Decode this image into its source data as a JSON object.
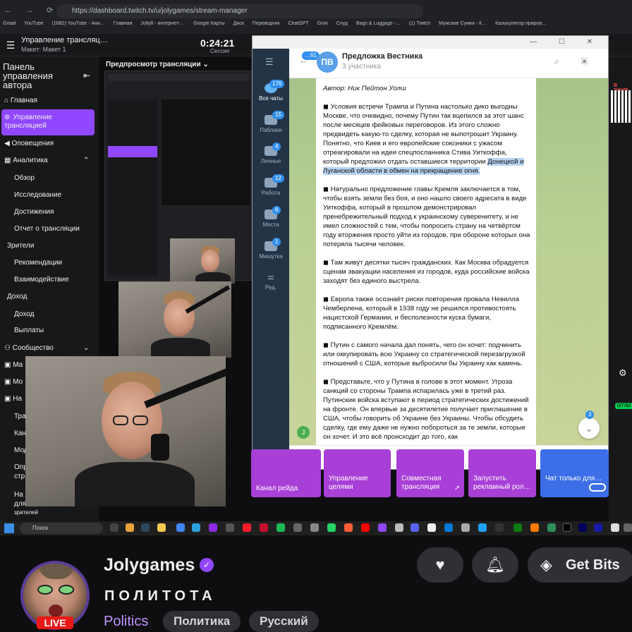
{
  "browser": {
    "url": "https://dashboard.twitch.tv/u/jolygames/stream-manager",
    "nav": "← → ⟳ ⌂",
    "bookmarks": [
      "Gmail",
      "YouTube",
      "(1682) YouTube - Ани…",
      "Главная",
      "Jolly8 - интернет-…",
      "Google Карты",
      "Диск",
      "Переводчик",
      "ChatGPT",
      "Grok",
      "Спуд",
      "Bags & Luggage -…",
      "(1) Twitch",
      "Мужские Сумки - К…",
      "Калькулятор приров…"
    ]
  },
  "twitch_header": {
    "title": "Управление трансляц…",
    "subtitle": "Макет: Макет 1",
    "session_time": "0:24:21",
    "session_label": "Сессия",
    "menu_icon": "hamburger-icon"
  },
  "sidebar": {
    "title": "Панель управления автора",
    "items": [
      {
        "label": "Главная",
        "icon": "home-icon"
      },
      {
        "label": "Управление трансляцией",
        "icon": "broadcast-icon",
        "active": true
      },
      {
        "label": "Оповещения",
        "icon": "megaphone-icon"
      },
      {
        "label": "Аналитика",
        "icon": "analytics-icon"
      },
      {
        "label": "Обзор"
      },
      {
        "label": "Исследование"
      },
      {
        "label": "Достижения"
      },
      {
        "label": "Отчет о трансляции"
      },
      {
        "label": "Зрители"
      },
      {
        "label": "Рекомендации"
      },
      {
        "label": "Взаимодействие"
      },
      {
        "label": "Доход"
      },
      {
        "label": "Доход"
      },
      {
        "label": "Выплаты"
      },
      {
        "label": "Сообщество",
        "icon": "community-icon"
      },
      {
        "label": "Ма"
      },
      {
        "label": "Мо"
      },
      {
        "label": "На"
      },
      {
        "label": "Тра"
      },
      {
        "label": "Кан"
      },
      {
        "label": "Мод"
      },
      {
        "label": "Опр"
      },
      {
        "label": "стр"
      },
      {
        "label": "На"
      },
      {
        "label": "для"
      },
      {
        "label": "зрителей"
      }
    ]
  },
  "preview": {
    "title": "Предпросмотр трансляции"
  },
  "telegram": {
    "window_controls": "— ☐ ✕",
    "chat_name": "Предложка Вестника",
    "members": "3 участника",
    "avatar_initials": "ПВ",
    "back_badge": "…61",
    "folders": [
      {
        "label": "Все чаты",
        "badge": "176"
      },
      {
        "label": "Паблики",
        "badge": "15"
      },
      {
        "label": "Личные",
        "badge": "4"
      },
      {
        "label": "Работа",
        "badge": "12"
      },
      {
        "label": "Места",
        "badge": "6"
      },
      {
        "label": "Мишутка",
        "badge": "1"
      },
      {
        "label": "Ред."
      }
    ],
    "message": {
      "author": "Автор: Ник Пейтон Уолш",
      "p1a": "◼ Условия встречи Трампа и Путина настолько дико выгодны Москве, что очевидно, почему Путин так вцепился за этот шанс после месяцев фейковых переговоров. Из этого сложно предвидеть какую-то сделку, которая не выпотрошит Украину. Понятно, что Киев и его европейские союзники с ужасом отреагировали на идеи спецпосланника Стива Уиткоффа, который предложил отдать оставшиеся территории ",
      "p1b": "Донецкой и Луганской области в обмен на прекращение огня.",
      "p2": "◼ Натурально предложение главы Кремля заключается в том, чтобы взять земли без боя, и оно нашло своего адресата в виде Уиткоффа, который в прошлом демонстрировал пренебрежительный подход к украинскому суверенитету, и не имел сложностей с тем, чтобы попросить страну на четвёртом году вторжения просто уйти из городов, при обороне которых она потеряла тысячи человек.",
      "p3": "◼ Там живут десятки тысяч гражданских. Как Москва обрадуется сценам эвакуации населения из городов, куда российские войска заходят без единого выстрела.",
      "p4": "◼ Европа также осознаёт риски повторения провала Невилла Чемберлена, который в 1938 году не решился противостоять нацистской Германии, и бесполезности куска бумаги, подписанного Кремлём.",
      "p5": "◼ Путин с самого начала дал понять, чего он хочет: подчинить или оккупировать всю Украину со стратегической перезагрузкой отношений с США, которые выбросили бы Украину как камень.",
      "p6": "◼ Представьте, что у Путина в голове в этот момент. Угроза санкций со стороны Трампа испарилась уже в третий раз. Путинские войска вступают в период стратегических достижений на фронте. Он впервые за десятилетие получает приглашение в США, чтобы говорить об Украине без Украины. Чтобы обсудить сделку, где ему даже не нужно побороться за те земли, которые он хочет. И это всё происходит до того, как"
    },
    "scroll_badge": "3",
    "user_initial": "J",
    "header_icons": "⌕ ▣ ⋮",
    "input_icons": "/ ☺ 🎙"
  },
  "right_edge": {
    "live_label": "В ЭФИР",
    "green_badge": "ОТЛИ"
  },
  "quick_actions": [
    {
      "label": "Канал рейда",
      "color": "#a83fd6"
    },
    {
      "label": "Управление целями",
      "color": "#a83fd6"
    },
    {
      "label": "Совместная трансляция",
      "color": "#a83fd6"
    },
    {
      "label": "Запустить рекламный рол…",
      "color": "#a83fd6"
    },
    {
      "label": "Чат только для…",
      "color": "#3c6ee8"
    }
  ],
  "taskbar": {
    "search_placeholder": "Поиск"
  },
  "channel": {
    "name": "Jolygames",
    "stream_title": "ПОЛИТОТА",
    "category": "Politics",
    "tags": [
      "Политика",
      "Русский"
    ],
    "live_badge": "LIVE",
    "get_bits": "Get Bits",
    "follow_icon": "heart-icon",
    "notify_icon": "bell-icon",
    "bits_icon": "bits-icon"
  }
}
